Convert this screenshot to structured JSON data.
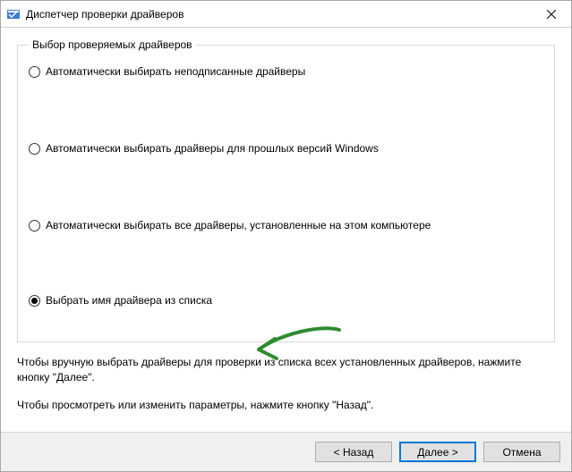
{
  "window": {
    "title": "Диспетчер проверки драйверов"
  },
  "group": {
    "legend": "Выбор проверяемых драйверов",
    "options": [
      {
        "label": "Автоматически выбирать неподписанные драйверы",
        "selected": false
      },
      {
        "label": "Автоматически выбирать драйверы для прошлых версий Windows",
        "selected": false
      },
      {
        "label": "Автоматически выбирать все драйверы, установленные на этом компьютере",
        "selected": false
      },
      {
        "label": "Выбрать имя драйвера из списка",
        "selected": true
      }
    ]
  },
  "instructions": {
    "line1": "Чтобы вручную выбрать драйверы для проверки из списка всех установленных драйверов, нажмите кнопку \"Далее\".",
    "line2": "Чтобы просмотреть или изменить параметры, нажмите кнопку \"Назад\"."
  },
  "buttons": {
    "back": "< Назад",
    "next": "Далее >",
    "cancel": "Отмена"
  }
}
